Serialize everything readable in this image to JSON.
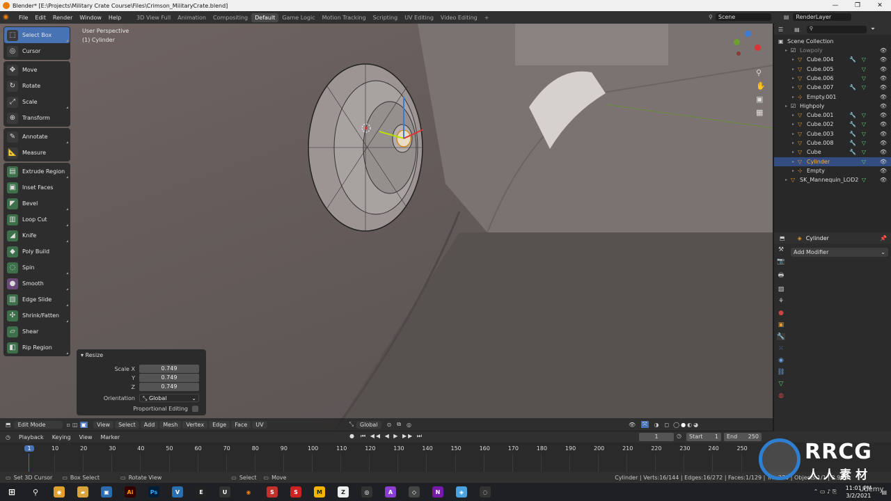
{
  "window": {
    "title": "Blender* [E:\\Projects\\Military Crate Course\\Files\\Crimson_MilitaryCrate.blend]",
    "minimize": "—",
    "maximize": "❐",
    "close": "✕"
  },
  "menus": [
    "File",
    "Edit",
    "Render",
    "Window",
    "Help"
  ],
  "workspaces": [
    "3D View Full",
    "Animation",
    "Compositing",
    "Default",
    "Game Logic",
    "Motion Tracking",
    "Scripting",
    "UV Editing",
    "Video Editing"
  ],
  "active_workspace": "Default",
  "add_workspace": "+",
  "scene": {
    "scene_name": "Scene",
    "render_layer": "RenderLayer"
  },
  "viewport": {
    "perspective": "User Perspective",
    "object_label": "(1) Cylinder"
  },
  "toolbar": [
    {
      "label": "Select Box",
      "icon": "select-box-icon"
    },
    {
      "label": "Cursor",
      "icon": "cursor-icon"
    },
    {
      "label": "Move",
      "icon": "move-icon"
    },
    {
      "label": "Rotate",
      "icon": "rotate-icon"
    },
    {
      "label": "Scale",
      "icon": "scale-icon"
    },
    {
      "label": "Transform",
      "icon": "transform-icon"
    },
    {
      "label": "Annotate",
      "icon": "annotate-icon"
    },
    {
      "label": "Measure",
      "icon": "measure-icon"
    },
    {
      "label": "Extrude Region",
      "icon": "extrude-icon"
    },
    {
      "label": "Inset Faces",
      "icon": "inset-icon"
    },
    {
      "label": "Bevel",
      "icon": "bevel-icon"
    },
    {
      "label": "Loop Cut",
      "icon": "loop-cut-icon"
    },
    {
      "label": "Knife",
      "icon": "knife-icon"
    },
    {
      "label": "Poly Build",
      "icon": "poly-build-icon"
    },
    {
      "label": "Spin",
      "icon": "spin-icon"
    },
    {
      "label": "Smooth",
      "icon": "smooth-icon"
    },
    {
      "label": "Edge Slide",
      "icon": "edge-slide-icon"
    },
    {
      "label": "Shrink/Fatten",
      "icon": "shrink-fatten-icon"
    },
    {
      "label": "Shear",
      "icon": "shear-icon"
    },
    {
      "label": "Rip Region",
      "icon": "rip-region-icon"
    }
  ],
  "resize_panel": {
    "title": "Resize",
    "scale_x_label": "Scale X",
    "y_label": "Y",
    "z_label": "Z",
    "scale_x": "0.749",
    "scale_y": "0.749",
    "scale_z": "0.749",
    "orientation_label": "Orientation",
    "orientation_value": "Global",
    "proportional_label": "Proportional Editing"
  },
  "header3d": {
    "mode": "Edit Mode",
    "menus": [
      "View",
      "Select",
      "Add",
      "Mesh",
      "Vertex",
      "Edge",
      "Face",
      "UV"
    ],
    "orientation": "Global"
  },
  "outliner": {
    "collection": "Scene Collection",
    "rows": [
      {
        "name": "Lowpoly",
        "kind": "collection",
        "indent": 1,
        "dim": true
      },
      {
        "name": "Cube.004",
        "kind": "mesh",
        "indent": 2
      },
      {
        "name": "Cube.005",
        "kind": "mesh",
        "indent": 2
      },
      {
        "name": "Cube.006",
        "kind": "mesh",
        "indent": 2
      },
      {
        "name": "Cube.007",
        "kind": "mesh",
        "indent": 2
      },
      {
        "name": "Empty.001",
        "kind": "empty",
        "indent": 2
      },
      {
        "name": "Highpoly",
        "kind": "collection",
        "indent": 1
      },
      {
        "name": "Cube.001",
        "kind": "mesh",
        "indent": 2
      },
      {
        "name": "Cube.002",
        "kind": "mesh",
        "indent": 2
      },
      {
        "name": "Cube.003",
        "kind": "mesh",
        "indent": 2
      },
      {
        "name": "Cube.008",
        "kind": "mesh",
        "indent": 2
      },
      {
        "name": "Cube",
        "kind": "mesh",
        "indent": 2
      },
      {
        "name": "Cylinder",
        "kind": "mesh",
        "indent": 2,
        "selected": true
      },
      {
        "name": "Empty",
        "kind": "empty",
        "indent": 2
      },
      {
        "name": "SK_Mannequin_LOD2",
        "kind": "mesh",
        "indent": 1
      }
    ]
  },
  "properties": {
    "object_name": "Cylinder",
    "add_modifier": "Add Modifier"
  },
  "timeline": {
    "menus": [
      "Playback",
      "Keying",
      "View",
      "Marker"
    ],
    "current_frame": "1",
    "start_label": "Start",
    "start": "1",
    "end_label": "End",
    "end": "250",
    "ticks": [
      "1",
      "10",
      "20",
      "30",
      "40",
      "50",
      "60",
      "70",
      "80",
      "90",
      "100",
      "110",
      "120",
      "130",
      "140",
      "150",
      "160",
      "170",
      "180",
      "190",
      "200",
      "210",
      "220",
      "230",
      "240",
      "250"
    ]
  },
  "status": {
    "set_cursor": "Set 3D Cursor",
    "box_select": "Box Select",
    "rotate_view": "Rotate View",
    "select": "Select",
    "move": "Move",
    "stats": "Cylinder | Verts:16/144 | Edges:16/272 | Faces:1/129 | Tris:270 | Objects:1/1 | 2.90.1"
  },
  "taskbar": {
    "time": "11:01 PM",
    "date": "3/2/2021"
  },
  "watermark": {
    "brand": "RRCG",
    "sub": "人人素材",
    "udemy": "Udemy"
  },
  "colors": {
    "accent": "#4772b3",
    "orange": "#e8972c",
    "selected_row": "#334d80",
    "viewport": "#655c5a"
  }
}
